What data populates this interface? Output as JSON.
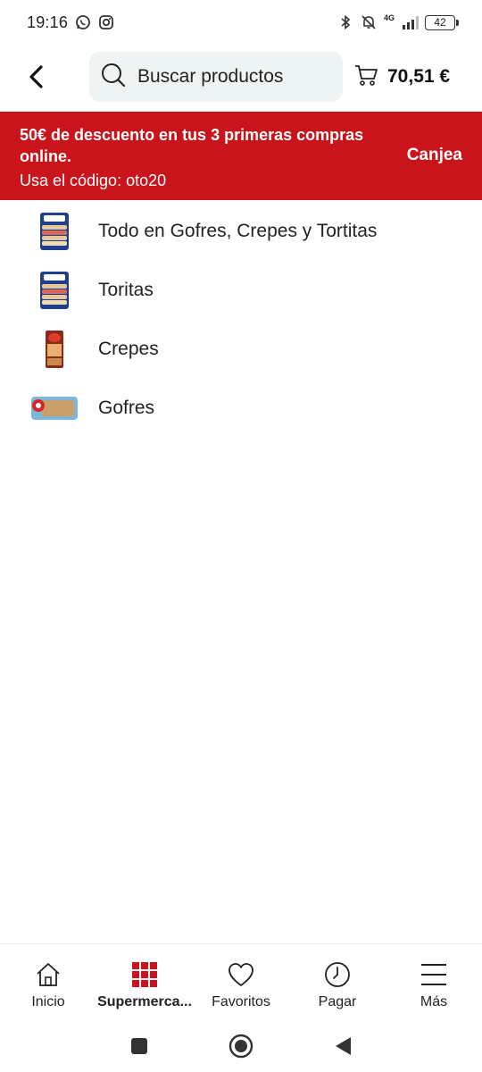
{
  "status_bar": {
    "time": "19:16",
    "network": "4G",
    "battery": "42",
    "icons": [
      "whatsapp-icon",
      "instagram-icon",
      "bluetooth-icon",
      "bell-off-icon",
      "signal-icon",
      "battery-icon"
    ]
  },
  "header": {
    "search_placeholder": "Buscar productos",
    "cart_total": "70,51 €"
  },
  "promo": {
    "title": "50€ de descuento en tus 3 primeras compras online.",
    "code_text": "Usa el código: oto20",
    "cta": "Canjea",
    "background": "#c8141a"
  },
  "categories": [
    {
      "label": "Todo en Gofres, Crepes y Tortitas",
      "thumb": "tortitas-pack-thumbnail"
    },
    {
      "label": "Toritas",
      "thumb": "tortitas-pack-thumbnail"
    },
    {
      "label": "Crepes",
      "thumb": "crepes-pack-thumbnail"
    },
    {
      "label": "Gofres",
      "thumb": "gofres-pack-thumbnail"
    }
  ],
  "bottom_nav": [
    {
      "label": "Inicio",
      "icon": "home-icon",
      "active": false
    },
    {
      "label": "Supermerca...",
      "icon": "grid-icon",
      "active": true
    },
    {
      "label": "Favoritos",
      "icon": "heart-icon",
      "active": false
    },
    {
      "label": "Pagar",
      "icon": "clock-icon",
      "active": false
    },
    {
      "label": "Más",
      "icon": "menu-icon",
      "active": false
    }
  ],
  "colors": {
    "accent": "#c8141a",
    "search_bg": "#eef4f4"
  }
}
